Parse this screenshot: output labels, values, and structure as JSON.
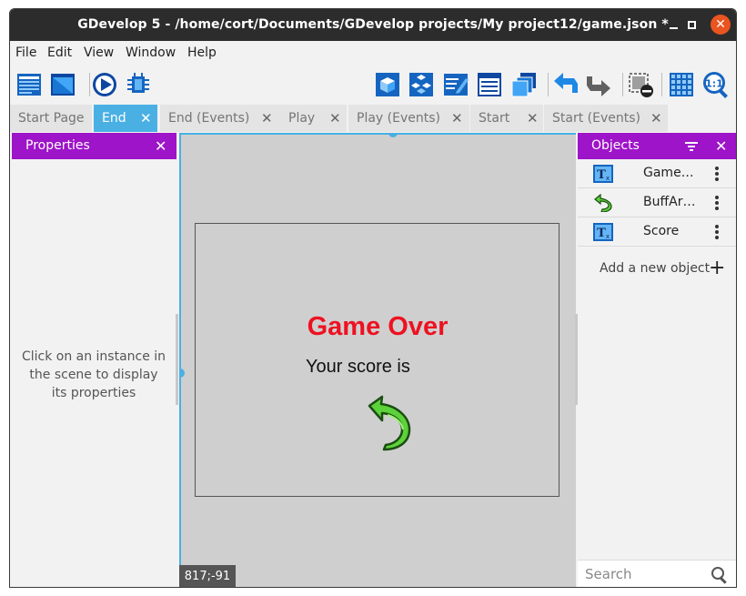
{
  "window": {
    "title": "GDevelop 5 - /home/cort/Documents/GDevelop projects/My project12/game.json *",
    "close_symbol": "✕"
  },
  "menu": [
    "File",
    "Edit",
    "View",
    "Window",
    "Help"
  ],
  "toolbar": {
    "left_icons": [
      "project-manager-icon",
      "scene-editor-icon",
      "preview-play-icon",
      "debugger-icon"
    ],
    "right_icons": [
      "object-icon",
      "object-groups-icon",
      "properties-edit-icon",
      "layers-icon",
      "instances-list-icon",
      "undo-icon",
      "redo-icon",
      "delete-instance-icon",
      "grid-icon",
      "zoom-reset-icon"
    ],
    "zoom_label": "1:1"
  },
  "tabs": [
    {
      "label": "Start Page",
      "closable": false,
      "active": false
    },
    {
      "label": "End",
      "closable": true,
      "active": true
    },
    {
      "label": "End (Events)",
      "closable": true,
      "active": false
    },
    {
      "label": "Play",
      "closable": true,
      "active": false
    },
    {
      "label": "Play (Events)",
      "closable": true,
      "active": false
    },
    {
      "label": "Start",
      "closable": true,
      "active": false
    },
    {
      "label": "Start (Events)",
      "closable": true,
      "active": false
    }
  ],
  "tab_close_symbol": "✕",
  "properties": {
    "title": "Properties",
    "hint": "Click on an instance in the scene to display its properties"
  },
  "scene": {
    "game_over_text": "Game Over",
    "score_text": "Your score is",
    "cursor_coords": "817;-91",
    "colors": {
      "background": "#cfcfcf",
      "game_over": "#ee1122",
      "guide": "#4ab0e4"
    }
  },
  "objects": {
    "title": "Objects",
    "items": [
      {
        "name": "Game…",
        "icon": "text-object-icon"
      },
      {
        "name": "BuffAr…",
        "icon": "sprite-arrow-icon"
      },
      {
        "name": "Score",
        "icon": "text-object-icon"
      }
    ],
    "add_label": "Add a new object",
    "add_symbol": "+",
    "search_placeholder": "Search"
  },
  "colors": {
    "panel_header": "#9e14c8",
    "active_tab": "#4ab0e4",
    "titlebar": "#2c2c2c",
    "close_button": "#e95420"
  }
}
